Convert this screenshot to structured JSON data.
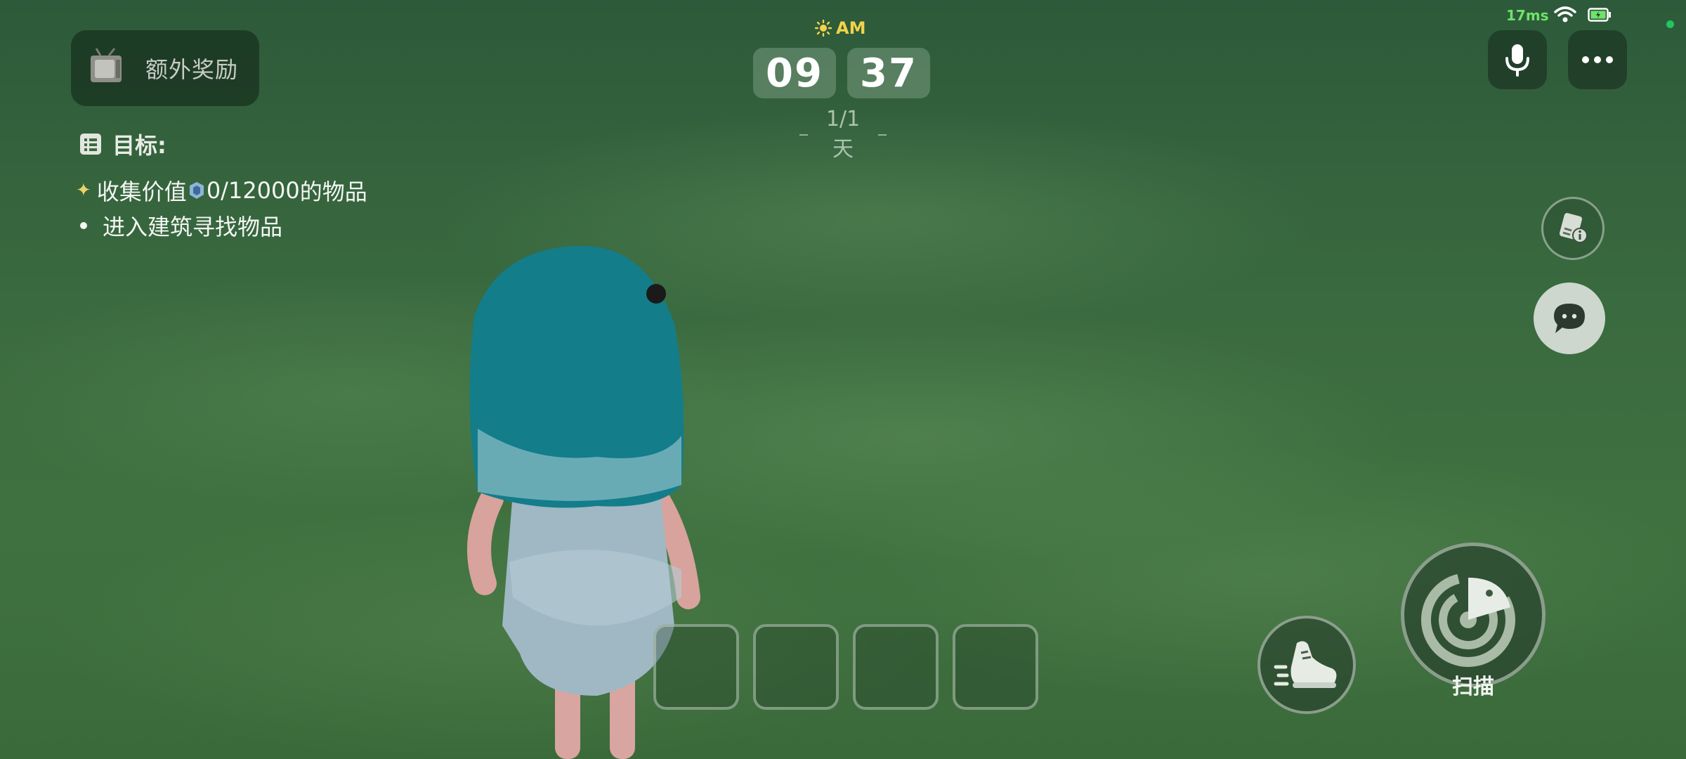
{
  "hud": {
    "bonus": {
      "label": "额外奖励",
      "icon": "tv-icon"
    },
    "objectives": {
      "title": "目标:",
      "items": [
        {
          "prefix": "收集价值",
          "value_text": "0/12000",
          "suffix": "的物品",
          "marker": "star"
        },
        {
          "text": "进入建筑寻找物品",
          "marker": "dot"
        }
      ]
    },
    "clock": {
      "period": "AM",
      "hours": "09",
      "minutes": "37",
      "day": "1/1天"
    },
    "status": {
      "ping": "17ms"
    },
    "actions": {
      "scan_label": "扫描"
    }
  },
  "inventory": {
    "slots": [
      {},
      {},
      {},
      {}
    ]
  },
  "colors": {
    "ping": "#6ee36a",
    "sun": "#f3d24a",
    "online_dot": "#22c55e",
    "background": "#3a6a3f"
  }
}
